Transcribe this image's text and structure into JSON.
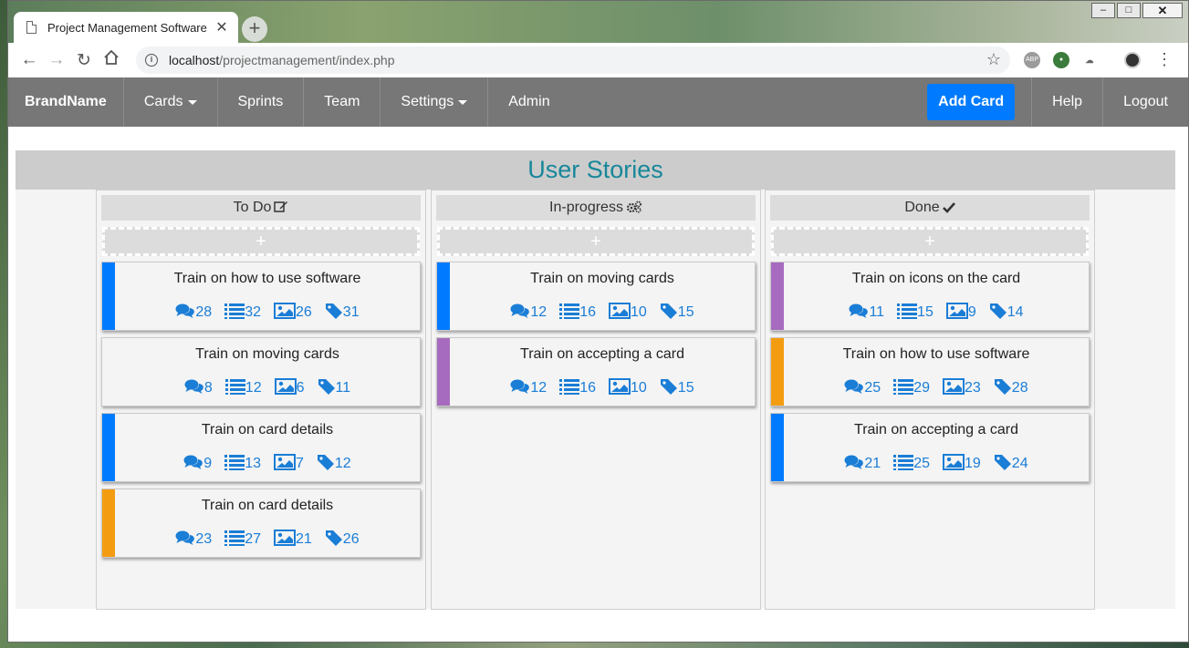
{
  "browser": {
    "tab_title": "Project Management Software",
    "tab_close": "✕",
    "new_tab": "+",
    "url_host": "localhost",
    "url_path": "/projectmanagement/index.php",
    "window_controls": {
      "minimize": "–",
      "maximize": "□",
      "close": "✕"
    }
  },
  "nav": {
    "brand": "BrandName",
    "items": [
      "Cards",
      "Sprints",
      "Team",
      "Settings",
      "Admin"
    ],
    "add_card": "Add Card",
    "help": "Help",
    "logout": "Logout"
  },
  "board": {
    "title": "User Stories",
    "add_symbol": "+",
    "columns": [
      {
        "name": "To Do",
        "icon": "edit-icon",
        "cards": [
          {
            "title": "Train on how to use software",
            "stripe": "#007bff",
            "comments": "28",
            "tasks": "32",
            "images": "26",
            "tags": "31"
          },
          {
            "title": "Train on moving cards",
            "stripe": "",
            "comments": "8",
            "tasks": "12",
            "images": "6",
            "tags": "11"
          },
          {
            "title": "Train on card details",
            "stripe": "#007bff",
            "comments": "9",
            "tasks": "13",
            "images": "7",
            "tags": "12"
          },
          {
            "title": "Train on card details",
            "stripe": "#f39c12",
            "comments": "23",
            "tasks": "27",
            "images": "21",
            "tags": "26"
          }
        ]
      },
      {
        "name": "In-progress",
        "icon": "gears-icon",
        "cards": [
          {
            "title": "Train on moving cards",
            "stripe": "#007bff",
            "comments": "12",
            "tasks": "16",
            "images": "10",
            "tags": "15"
          },
          {
            "title": "Train on accepting a card",
            "stripe": "#a66bbe",
            "comments": "12",
            "tasks": "16",
            "images": "10",
            "tags": "15"
          }
        ]
      },
      {
        "name": "Done",
        "icon": "check-icon",
        "cards": [
          {
            "title": "Train on icons on the card",
            "stripe": "#a66bbe",
            "comments": "11",
            "tasks": "15",
            "images": "9",
            "tags": "14"
          },
          {
            "title": "Train on how to use software",
            "stripe": "#f39c12",
            "comments": "25",
            "tasks": "29",
            "images": "23",
            "tags": "28"
          },
          {
            "title": "Train on accepting a card",
            "stripe": "#007bff",
            "comments": "21",
            "tasks": "25",
            "images": "19",
            "tags": "24"
          }
        ]
      }
    ]
  }
}
